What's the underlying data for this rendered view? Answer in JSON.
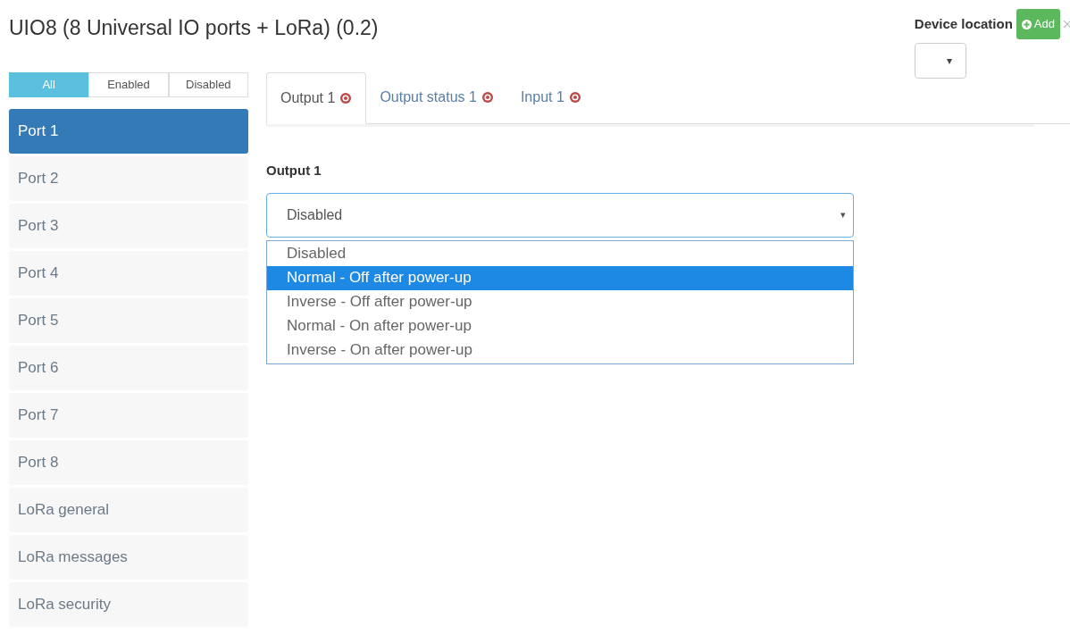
{
  "title": "UIO8 (8 Universal IO ports + LoRa) (0.2)",
  "device_location": {
    "label": "Device location",
    "add_button": "Add",
    "select_value": "▾"
  },
  "filters": [
    {
      "label": "All",
      "selected": true
    },
    {
      "label": "Enabled",
      "selected": false
    },
    {
      "label": "Disabled",
      "selected": false
    }
  ],
  "sidebar": {
    "items": [
      {
        "label": "Port 1",
        "selected": true
      },
      {
        "label": "Port 2",
        "selected": false
      },
      {
        "label": "Port 3",
        "selected": false
      },
      {
        "label": "Port 4",
        "selected": false
      },
      {
        "label": "Port 5",
        "selected": false
      },
      {
        "label": "Port 6",
        "selected": false
      },
      {
        "label": "Port 7",
        "selected": false
      },
      {
        "label": "Port 8",
        "selected": false
      },
      {
        "label": "LoRa general",
        "selected": false
      },
      {
        "label": "LoRa messages",
        "selected": false
      },
      {
        "label": "LoRa security",
        "selected": false
      }
    ]
  },
  "tabs": [
    {
      "label": "Output 1",
      "selected": true
    },
    {
      "label": "Output status 1",
      "selected": false
    },
    {
      "label": "Input 1",
      "selected": false
    }
  ],
  "field": {
    "label": "Output 1",
    "value": "Disabled",
    "caret": "▾",
    "expanded": true,
    "options": [
      {
        "label": "Disabled",
        "highlighted": false
      },
      {
        "label": "Normal - Off after power-up",
        "highlighted": true
      },
      {
        "label": "Inverse - Off after power-up",
        "highlighted": false
      },
      {
        "label": "Normal - On after power-up",
        "highlighted": false
      },
      {
        "label": "Inverse - On after power-up",
        "highlighted": false
      }
    ]
  }
}
